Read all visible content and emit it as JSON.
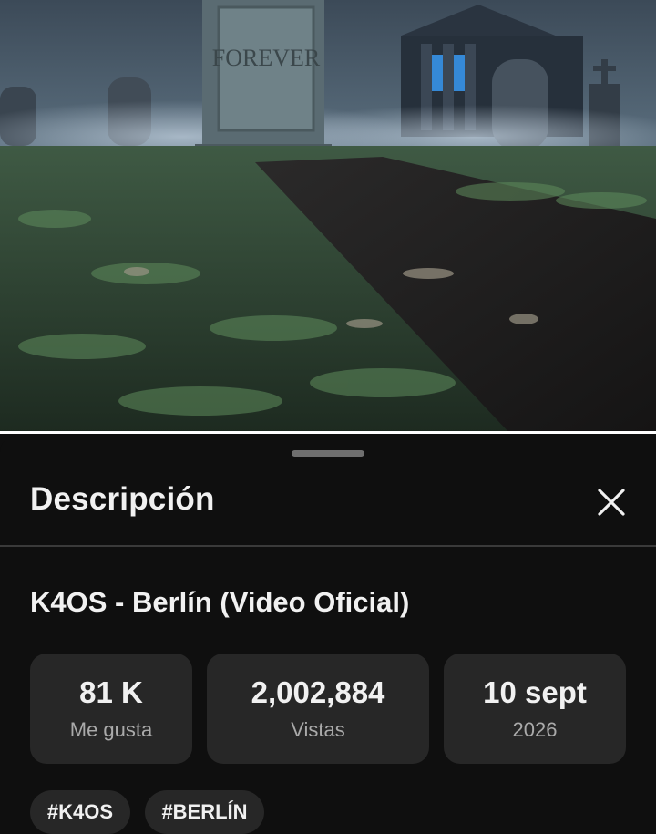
{
  "video": {
    "thumbnail": "cemetery-scene",
    "tombstone_text": "FOREVER",
    "progress_fraction": 1.0
  },
  "description_panel": {
    "title": "Descripción",
    "close_icon": "close-icon"
  },
  "video_info": {
    "title": "K4OS - Berlín (Video Oficial)",
    "stats": [
      {
        "value": "81 K",
        "label": "Me gusta"
      },
      {
        "value": "2,002,884",
        "label": "Vistas"
      },
      {
        "value": "10 sept",
        "label": "2026"
      }
    ],
    "hashtags": [
      "#K4OS",
      "#BERLÍN"
    ]
  },
  "colors": {
    "background": "#0f0f0f",
    "card": "#272727",
    "text_primary": "#f1f1f1",
    "text_secondary": "#aaaaaa"
  }
}
